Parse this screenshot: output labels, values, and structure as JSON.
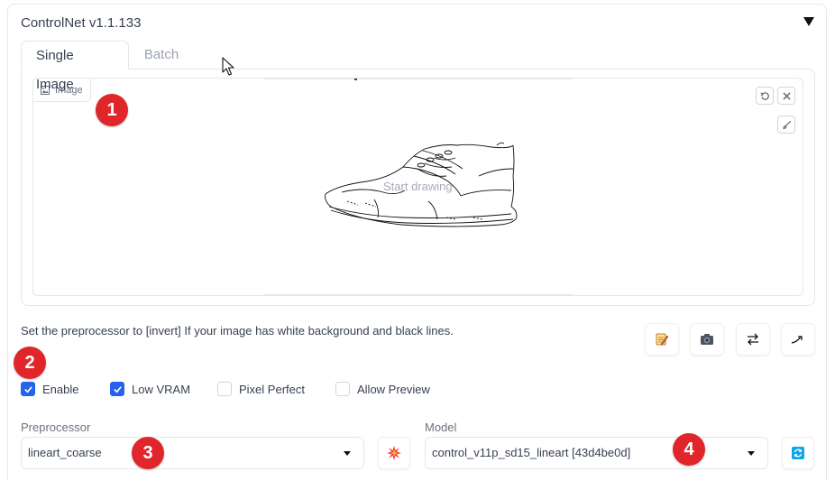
{
  "panel": {
    "title": "ControlNet v1.1.133"
  },
  "tabs": [
    {
      "label": "Single Image",
      "active": true
    },
    {
      "label": "Batch",
      "active": false
    }
  ],
  "image_input": {
    "label": "Image",
    "placeholder": "Start drawing",
    "buttons": [
      "undo-icon",
      "close-icon",
      "brush-icon"
    ]
  },
  "hint": "Set the preprocessor to [invert] If your image has white background and black lines.",
  "tool_buttons": [
    "edit-icon",
    "camera-icon",
    "swap-icon",
    "send-icon"
  ],
  "checkboxes": [
    {
      "label": "Enable",
      "checked": true
    },
    {
      "label": "Low VRAM",
      "checked": true
    },
    {
      "label": "Pixel Perfect",
      "checked": false
    },
    {
      "label": "Allow Preview",
      "checked": false
    }
  ],
  "preprocessor": {
    "label": "Preprocessor",
    "value": "lineart_coarse",
    "run_icon": "explosion-icon"
  },
  "model": {
    "label": "Model",
    "value": "control_v11p_sd15_lineart [43d4be0d]",
    "refresh_icon": "refresh-icon"
  },
  "annotations": [
    "1",
    "2",
    "3",
    "4"
  ],
  "colors": {
    "accent": "#2563eb",
    "badge": "#e0262b",
    "border": "#e5e7eb"
  }
}
